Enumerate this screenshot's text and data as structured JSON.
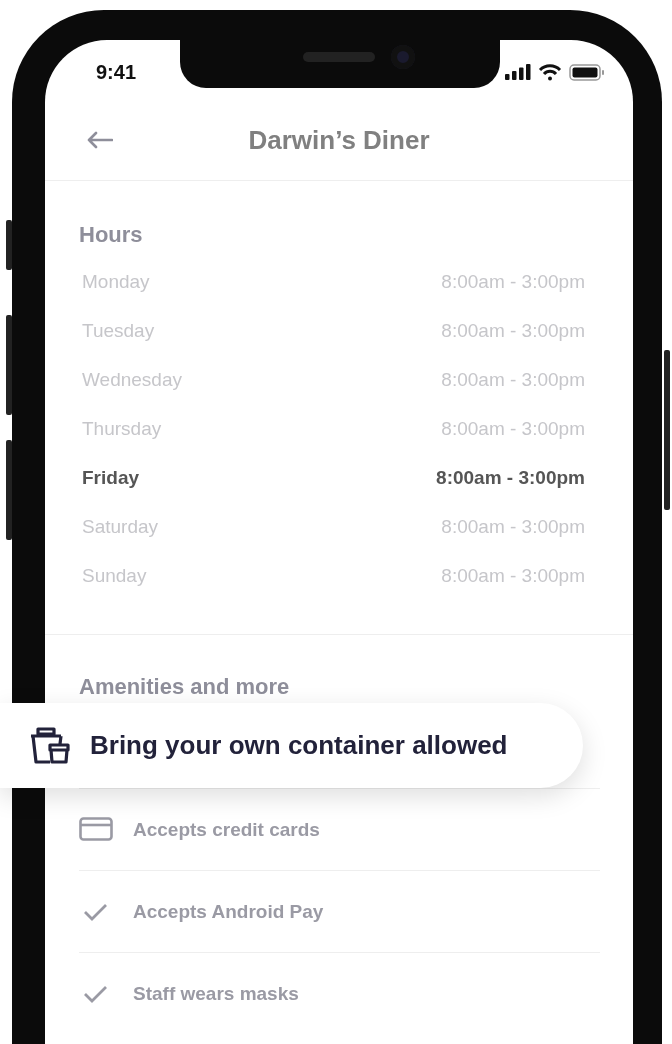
{
  "status_bar": {
    "time": "9:41"
  },
  "header": {
    "title": "Darwin’s Diner"
  },
  "hours": {
    "title": "Hours",
    "days": [
      {
        "day": "Monday",
        "hours": "8:00am - 3:00pm",
        "today": false
      },
      {
        "day": "Tuesday",
        "hours": "8:00am - 3:00pm",
        "today": false
      },
      {
        "day": "Wednesday",
        "hours": "8:00am - 3:00pm",
        "today": false
      },
      {
        "day": "Thursday",
        "hours": "8:00am - 3:00pm",
        "today": false
      },
      {
        "day": "Friday",
        "hours": "8:00am - 3:00pm",
        "today": true
      },
      {
        "day": "Saturday",
        "hours": "8:00am - 3:00pm",
        "today": false
      },
      {
        "day": "Sunday",
        "hours": "8:00am - 3:00pm",
        "today": false
      }
    ]
  },
  "amenities": {
    "title": "Amenities and more",
    "items": [
      {
        "label": "Bring your own container allowed",
        "kind": "container",
        "highlighted": true
      },
      {
        "label": "Accepts credit cards",
        "kind": "card",
        "highlighted": false
      },
      {
        "label": "Accepts Android Pay",
        "kind": "check",
        "highlighted": false
      },
      {
        "label": "Staff wears masks",
        "kind": "check",
        "highlighted": false
      }
    ]
  }
}
